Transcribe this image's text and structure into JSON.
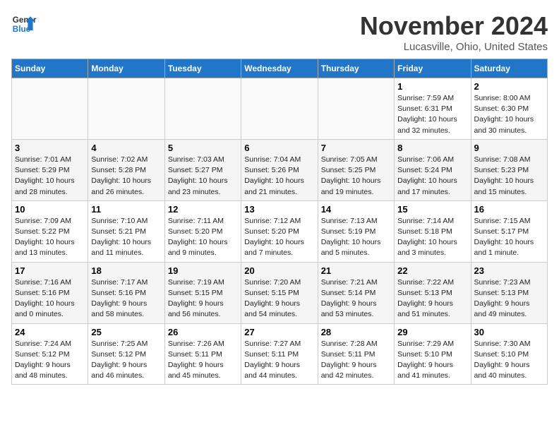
{
  "header": {
    "logo_line1": "General",
    "logo_line2": "Blue",
    "month": "November 2024",
    "location": "Lucasville, Ohio, United States"
  },
  "days_of_week": [
    "Sunday",
    "Monday",
    "Tuesday",
    "Wednesday",
    "Thursday",
    "Friday",
    "Saturday"
  ],
  "weeks": [
    [
      {
        "day": "",
        "info": ""
      },
      {
        "day": "",
        "info": ""
      },
      {
        "day": "",
        "info": ""
      },
      {
        "day": "",
        "info": ""
      },
      {
        "day": "",
        "info": ""
      },
      {
        "day": "1",
        "info": "Sunrise: 7:59 AM\nSunset: 6:31 PM\nDaylight: 10 hours\nand 32 minutes."
      },
      {
        "day": "2",
        "info": "Sunrise: 8:00 AM\nSunset: 6:30 PM\nDaylight: 10 hours\nand 30 minutes."
      }
    ],
    [
      {
        "day": "3",
        "info": "Sunrise: 7:01 AM\nSunset: 5:29 PM\nDaylight: 10 hours\nand 28 minutes."
      },
      {
        "day": "4",
        "info": "Sunrise: 7:02 AM\nSunset: 5:28 PM\nDaylight: 10 hours\nand 26 minutes."
      },
      {
        "day": "5",
        "info": "Sunrise: 7:03 AM\nSunset: 5:27 PM\nDaylight: 10 hours\nand 23 minutes."
      },
      {
        "day": "6",
        "info": "Sunrise: 7:04 AM\nSunset: 5:26 PM\nDaylight: 10 hours\nand 21 minutes."
      },
      {
        "day": "7",
        "info": "Sunrise: 7:05 AM\nSunset: 5:25 PM\nDaylight: 10 hours\nand 19 minutes."
      },
      {
        "day": "8",
        "info": "Sunrise: 7:06 AM\nSunset: 5:24 PM\nDaylight: 10 hours\nand 17 minutes."
      },
      {
        "day": "9",
        "info": "Sunrise: 7:08 AM\nSunset: 5:23 PM\nDaylight: 10 hours\nand 15 minutes."
      }
    ],
    [
      {
        "day": "10",
        "info": "Sunrise: 7:09 AM\nSunset: 5:22 PM\nDaylight: 10 hours\nand 13 minutes."
      },
      {
        "day": "11",
        "info": "Sunrise: 7:10 AM\nSunset: 5:21 PM\nDaylight: 10 hours\nand 11 minutes."
      },
      {
        "day": "12",
        "info": "Sunrise: 7:11 AM\nSunset: 5:20 PM\nDaylight: 10 hours\nand 9 minutes."
      },
      {
        "day": "13",
        "info": "Sunrise: 7:12 AM\nSunset: 5:20 PM\nDaylight: 10 hours\nand 7 minutes."
      },
      {
        "day": "14",
        "info": "Sunrise: 7:13 AM\nSunset: 5:19 PM\nDaylight: 10 hours\nand 5 minutes."
      },
      {
        "day": "15",
        "info": "Sunrise: 7:14 AM\nSunset: 5:18 PM\nDaylight: 10 hours\nand 3 minutes."
      },
      {
        "day": "16",
        "info": "Sunrise: 7:15 AM\nSunset: 5:17 PM\nDaylight: 10 hours\nand 1 minute."
      }
    ],
    [
      {
        "day": "17",
        "info": "Sunrise: 7:16 AM\nSunset: 5:16 PM\nDaylight: 10 hours\nand 0 minutes."
      },
      {
        "day": "18",
        "info": "Sunrise: 7:17 AM\nSunset: 5:16 PM\nDaylight: 9 hours\nand 58 minutes."
      },
      {
        "day": "19",
        "info": "Sunrise: 7:19 AM\nSunset: 5:15 PM\nDaylight: 9 hours\nand 56 minutes."
      },
      {
        "day": "20",
        "info": "Sunrise: 7:20 AM\nSunset: 5:15 PM\nDaylight: 9 hours\nand 54 minutes."
      },
      {
        "day": "21",
        "info": "Sunrise: 7:21 AM\nSunset: 5:14 PM\nDaylight: 9 hours\nand 53 minutes."
      },
      {
        "day": "22",
        "info": "Sunrise: 7:22 AM\nSunset: 5:13 PM\nDaylight: 9 hours\nand 51 minutes."
      },
      {
        "day": "23",
        "info": "Sunrise: 7:23 AM\nSunset: 5:13 PM\nDaylight: 9 hours\nand 49 minutes."
      }
    ],
    [
      {
        "day": "24",
        "info": "Sunrise: 7:24 AM\nSunset: 5:12 PM\nDaylight: 9 hours\nand 48 minutes."
      },
      {
        "day": "25",
        "info": "Sunrise: 7:25 AM\nSunset: 5:12 PM\nDaylight: 9 hours\nand 46 minutes."
      },
      {
        "day": "26",
        "info": "Sunrise: 7:26 AM\nSunset: 5:11 PM\nDaylight: 9 hours\nand 45 minutes."
      },
      {
        "day": "27",
        "info": "Sunrise: 7:27 AM\nSunset: 5:11 PM\nDaylight: 9 hours\nand 44 minutes."
      },
      {
        "day": "28",
        "info": "Sunrise: 7:28 AM\nSunset: 5:11 PM\nDaylight: 9 hours\nand 42 minutes."
      },
      {
        "day": "29",
        "info": "Sunrise: 7:29 AM\nSunset: 5:10 PM\nDaylight: 9 hours\nand 41 minutes."
      },
      {
        "day": "30",
        "info": "Sunrise: 7:30 AM\nSunset: 5:10 PM\nDaylight: 9 hours\nand 40 minutes."
      }
    ]
  ]
}
